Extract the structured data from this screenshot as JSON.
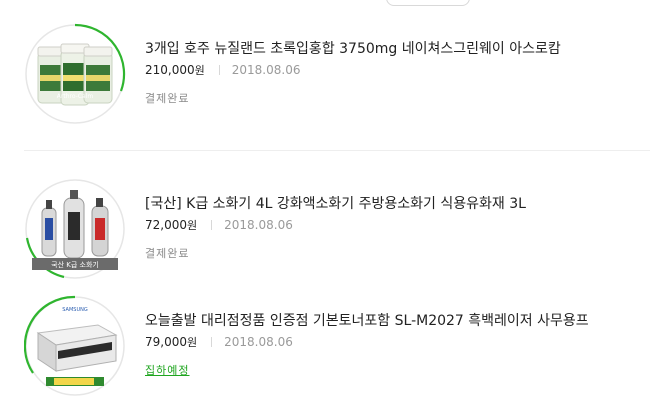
{
  "orders": [
    {
      "title": "3개입 호주 뉴질랜드 초록입홍합 3750mg 네이쳐스그린웨이 아스로캄",
      "price": "210,000",
      "currency": "원",
      "date": "2018.08.06",
      "status": "결제완료",
      "image_text": "Arthro-Calm",
      "progress_ring_color": "#2fb52f"
    },
    {
      "title": "[국산] K급 소화기 4L 강화액소화기 주방용소화기 식용유화재 3L",
      "price": "72,000",
      "currency": "원",
      "date": "2018.08.06",
      "status": "결제완료",
      "image_text": "국산 K급 소화기",
      "progress_ring_color": "#2fb52f"
    },
    {
      "title": "오늘출발 대리점정품 인증점 기본토너포함 SL-M2027 흑백레이저 사무용프",
      "price": "79,000",
      "currency": "원",
      "date": "2018.08.06",
      "status": "집하예정",
      "image_text": "SAMSUNG",
      "progress_ring_color": "#2fb52f"
    }
  ],
  "colors": {
    "title": "#222222",
    "date": "#9a9a9a",
    "status_done": "#8a8a8a",
    "status_pending": "#1fa51f",
    "ring": "#2fb52f"
  }
}
